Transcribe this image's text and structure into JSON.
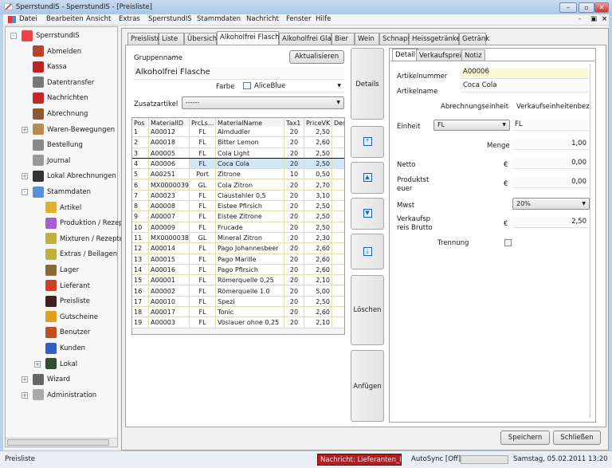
{
  "window": {
    "title": "SperrstundIS - SperrstundIS - [Preisliste]",
    "controls": [
      "–",
      "▫",
      "✕"
    ]
  },
  "menu": [
    "Datei",
    "Bearbeiten",
    "Ansicht",
    "Extras",
    "SperrstundIS",
    "Stammdaten",
    "Nachricht",
    "Fenster",
    "Hilfe"
  ],
  "mdi_controls": [
    "-",
    "▣",
    "×"
  ],
  "tree": [
    {
      "label": "SperrstundIS",
      "level": 0,
      "exp": "-",
      "color": "#e44"
    },
    {
      "label": "Abmelden",
      "level": 1,
      "color": "#b5452b"
    },
    {
      "label": "Kassa",
      "level": 1,
      "color": "#c02020"
    },
    {
      "label": "Datentransfer",
      "level": 1,
      "color": "#777"
    },
    {
      "label": "Nachrichten",
      "level": 1,
      "color": "#c42828"
    },
    {
      "label": "Abrechnung",
      "level": 1,
      "color": "#8a5a2b"
    },
    {
      "label": "Waren-Bewegungen",
      "level": 1,
      "exp": "+",
      "color": "#b98a50"
    },
    {
      "label": "Bestellung",
      "level": 1,
      "color": "#888"
    },
    {
      "label": "Journal",
      "level": 1,
      "color": "#999"
    },
    {
      "label": "Lokal Abrechnungen",
      "level": 1,
      "exp": "+",
      "color": "#333"
    },
    {
      "label": "Stammdaten",
      "level": 1,
      "exp": "-",
      "color": "#5a8fd8"
    },
    {
      "label": "Artikel",
      "level": 2,
      "color": "#e0b030"
    },
    {
      "label": "Produktion / Rezept",
      "level": 2,
      "color": "#a060d0"
    },
    {
      "label": "Mixturen / Rezepte",
      "level": 2,
      "color": "#c0b040"
    },
    {
      "label": "Extras / Beilagen",
      "level": 2,
      "color": "#c0b040"
    },
    {
      "label": "Lager",
      "level": 2,
      "color": "#8a6a3a"
    },
    {
      "label": "Lieferant",
      "level": 2,
      "color": "#d04020"
    },
    {
      "label": "Preisliste",
      "level": 2,
      "color": "#402020"
    },
    {
      "label": "Gutscheine",
      "level": 2,
      "color": "#e0a020"
    },
    {
      "label": "Benutzer",
      "level": 2,
      "color": "#c05020"
    },
    {
      "label": "Kunden",
      "level": 2,
      "color": "#3060c0"
    },
    {
      "label": "Lokal",
      "level": 2,
      "exp": "+",
      "color": "#305030"
    },
    {
      "label": "Wizard",
      "level": 1,
      "exp": "+",
      "color": "#666"
    },
    {
      "label": "Administration",
      "level": 1,
      "exp": "+",
      "color": "#aaa"
    }
  ],
  "tabs": [
    {
      "label": "Preisliste"
    },
    {
      "label": "Liste"
    },
    {
      "label": "Übersicht"
    },
    {
      "label": "Alkoholfrei Flasche",
      "active": true
    },
    {
      "label": "Alkoholfrei Glas"
    },
    {
      "label": "Bier"
    },
    {
      "label": "Wein"
    },
    {
      "label": "Schnaps"
    },
    {
      "label": "Heissgetränke"
    },
    {
      "label": "Getränk"
    }
  ],
  "group": {
    "label": "Gruppenname",
    "refresh": "Aktualisieren",
    "name": "Alkoholfrei Flasche",
    "color_label": "Farbe",
    "color_value": "AliceBlue",
    "extra_label": "Zusatzartikel",
    "extra_value": "------"
  },
  "grid": {
    "columns": [
      "Pos",
      "MaterialID",
      "PrcLs...",
      "MaterialName",
      "Tax1",
      "PriceVK",
      "Des"
    ],
    "selected": 3,
    "rows": [
      [
        "1",
        "A00012",
        "FL",
        "Almdudler",
        "20",
        "2,50"
      ],
      [
        "2",
        "A00018",
        "FL",
        "Bitter Lemon",
        "20",
        "2,60"
      ],
      [
        "3",
        "A00005",
        "FL",
        "Cola Light",
        "20",
        "2,50"
      ],
      [
        "4",
        "A00006",
        "FL",
        "Coca Cola",
        "20",
        "2,50"
      ],
      [
        "5",
        "A00251",
        "Port",
        "Zitrone",
        "10",
        "0,50"
      ],
      [
        "6",
        "MX0000039",
        "GL",
        "Cola Zitron",
        "20",
        "2,70"
      ],
      [
        "7",
        "A00023",
        "FL",
        "Claustahler 0,5",
        "20",
        "3,10"
      ],
      [
        "8",
        "A00008",
        "FL",
        "Eistee Pfirsich",
        "20",
        "2,50"
      ],
      [
        "9",
        "A00007",
        "FL",
        "Eistee Zitrone",
        "20",
        "2,50"
      ],
      [
        "10",
        "A00009",
        "FL",
        "Frucade",
        "20",
        "2,50"
      ],
      [
        "11",
        "MX0000038",
        "GL",
        "Mineral Zitron",
        "20",
        "2,30"
      ],
      [
        "12",
        "A00014",
        "FL",
        "Pago Johannesbeer",
        "20",
        "2,60"
      ],
      [
        "13",
        "A00015",
        "FL",
        "Pago Marille",
        "20",
        "2,60"
      ],
      [
        "14",
        "A00016",
        "FL",
        "Pago Pfirsich",
        "20",
        "2,60"
      ],
      [
        "15",
        "A00001",
        "FL",
        "Römerquelle 0,25",
        "20",
        "2,10"
      ],
      [
        "16",
        "A00002",
        "FL",
        "Römerquelle 1.0",
        "20",
        "5,00"
      ],
      [
        "17",
        "A00010",
        "FL",
        "Spezi",
        "20",
        "2,50"
      ],
      [
        "18",
        "A00017",
        "FL",
        "Tonic",
        "20",
        "2,60"
      ],
      [
        "19",
        "A00003",
        "FL",
        "Vöslauer ohne 0,25",
        "20",
        "2,10"
      ]
    ]
  },
  "side_buttons": {
    "details": "Details",
    "top": "⤒",
    "up": "▲",
    "down": "▼",
    "bottom": "⤓",
    "delete": "Löschen",
    "append": "Anfügen"
  },
  "detail": {
    "tabs": [
      "Detail",
      "Verkaufspreis",
      "Notiz"
    ],
    "artikelnummer_label": "Artikelnummer",
    "artikelnummer": "A00006",
    "artikelname_label": "Artikelname",
    "artikelname": "Coca Cola",
    "abrechnung_hdr": "Abrechnungseinheit",
    "verkauf_hdr": "Verkaufseinheitenbez.",
    "einheit_label": "Einheit",
    "einheit": "FL",
    "einheit_bez": "FL",
    "menge_label": "Menge",
    "menge": "1,00",
    "netto_label": "Netto",
    "currency": "€",
    "netto": "0,00",
    "produktsteuer_label1": "Produktst",
    "produktsteuer_label2": "euer",
    "produktsteuer": "0,00",
    "mwst_label": "Mwst",
    "mwst": "20%",
    "brutto_label1": "Verkaufsp",
    "brutto_label2": "reis Brutto",
    "brutto": "2,50",
    "trennung_label": "Trennung"
  },
  "footer": {
    "save": "Speichern",
    "close": "Schließen"
  },
  "status": {
    "left": "Preisliste",
    "message": "Nachricht: Lieferanten_M...",
    "autosync": "AutoSync [Off]",
    "datetime": "Samstag, 05.02.2011 13:20"
  }
}
